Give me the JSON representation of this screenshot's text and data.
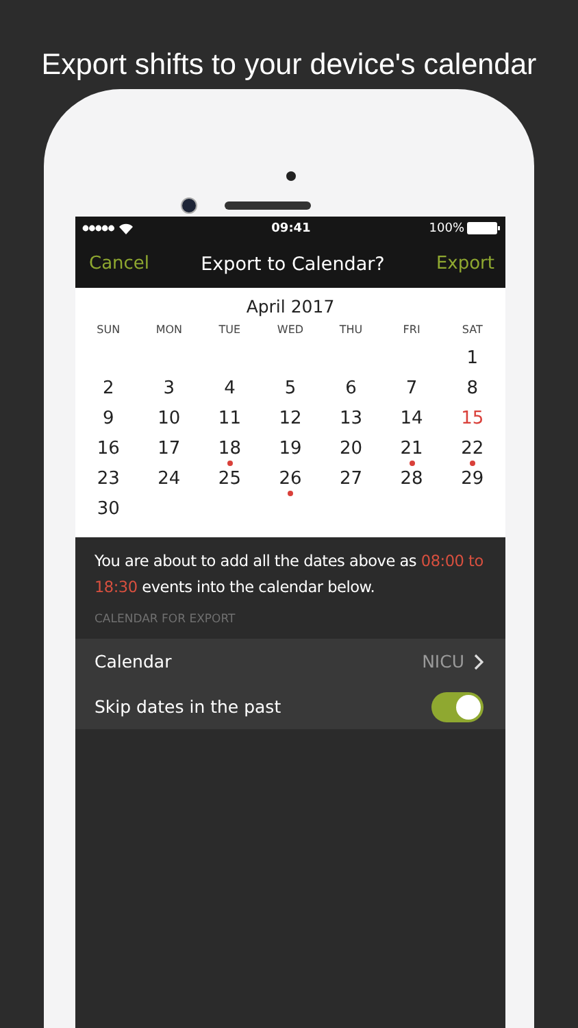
{
  "headline": "Export shifts to your device's calendar",
  "status_bar": {
    "time": "09:41",
    "battery": "100%"
  },
  "nav_bar": {
    "left": "Cancel",
    "title": "Export to Calendar?",
    "right": "Export"
  },
  "calendar": {
    "month": "April 2017",
    "weekdays": [
      "SUN",
      "MON",
      "TUE",
      "WED",
      "THU",
      "FRI",
      "SAT"
    ],
    "weeks": [
      {
        "kind": "leading",
        "days": [
          {
            "day": "1",
            "highlighted": false,
            "marked": false
          }
        ]
      },
      {
        "kind": "full",
        "days": [
          {
            "day": "2",
            "highlighted": false,
            "marked": false
          },
          {
            "day": "3",
            "highlighted": false,
            "marked": false
          },
          {
            "day": "4",
            "highlighted": false,
            "marked": false
          },
          {
            "day": "5",
            "highlighted": false,
            "marked": false
          },
          {
            "day": "6",
            "highlighted": false,
            "marked": false
          },
          {
            "day": "7",
            "highlighted": false,
            "marked": false
          },
          {
            "day": "8",
            "highlighted": false,
            "marked": false
          }
        ]
      },
      {
        "kind": "full",
        "days": [
          {
            "day": "9",
            "highlighted": false,
            "marked": false
          },
          {
            "day": "10",
            "highlighted": false,
            "marked": false
          },
          {
            "day": "11",
            "highlighted": false,
            "marked": false
          },
          {
            "day": "12",
            "highlighted": false,
            "marked": false
          },
          {
            "day": "13",
            "highlighted": false,
            "marked": false
          },
          {
            "day": "14",
            "highlighted": false,
            "marked": false
          },
          {
            "day": "15",
            "highlighted": true,
            "marked": false
          }
        ]
      },
      {
        "kind": "full",
        "days": [
          {
            "day": "16",
            "highlighted": false,
            "marked": false
          },
          {
            "day": "17",
            "highlighted": false,
            "marked": false
          },
          {
            "day": "18",
            "highlighted": false,
            "marked": true
          },
          {
            "day": "19",
            "highlighted": false,
            "marked": false
          },
          {
            "day": "20",
            "highlighted": false,
            "marked": false
          },
          {
            "day": "21",
            "highlighted": false,
            "marked": true
          },
          {
            "day": "22",
            "highlighted": false,
            "marked": true
          }
        ]
      },
      {
        "kind": "full",
        "days": [
          {
            "day": "23",
            "highlighted": false,
            "marked": false
          },
          {
            "day": "24",
            "highlighted": false,
            "marked": false
          },
          {
            "day": "25",
            "highlighted": false,
            "marked": false
          },
          {
            "day": "26",
            "highlighted": false,
            "marked": true
          },
          {
            "day": "27",
            "highlighted": false,
            "marked": false
          },
          {
            "day": "28",
            "highlighted": false,
            "marked": false
          },
          {
            "day": "29",
            "highlighted": false,
            "marked": false
          }
        ]
      },
      {
        "kind": "trailing",
        "days": [
          {
            "day": "30",
            "highlighted": false,
            "marked": false
          }
        ]
      }
    ]
  },
  "message": [
    {
      "text": "You are about to add all the dates above as ",
      "highlight": false
    },
    {
      "text": "08:00 to 18:30",
      "highlight": true
    },
    {
      "text": " events into the calendar below.",
      "highlight": false
    }
  ],
  "section_header": "CALENDAR FOR EXPORT",
  "settings": [
    {
      "kind": "disclosure",
      "label": "Calendar",
      "value": "NICU"
    },
    {
      "kind": "toggle",
      "label": "Skip dates in the past",
      "on": true
    }
  ]
}
